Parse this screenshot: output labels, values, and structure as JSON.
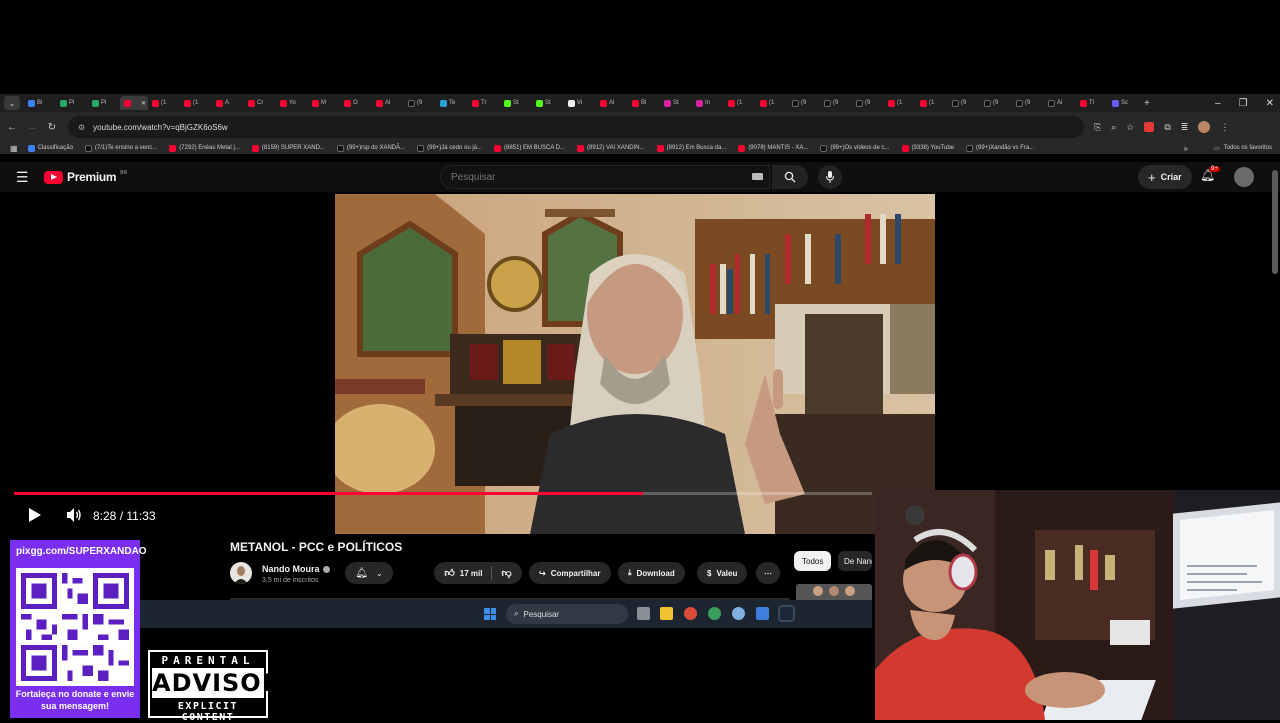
{
  "browser": {
    "tabs": [
      {
        "label": "Bi",
        "icon": "bl"
      },
      {
        "label": "Pi",
        "icon": "gr"
      },
      {
        "label": "Pi",
        "icon": "gr"
      },
      {
        "label": "",
        "icon": "yt",
        "active": true
      },
      {
        "label": "(1",
        "icon": "yt"
      },
      {
        "label": "(1",
        "icon": "yt"
      },
      {
        "label": "A",
        "icon": "yt"
      },
      {
        "label": "Cr",
        "icon": "yt"
      },
      {
        "label": "Yo",
        "icon": "yt"
      },
      {
        "label": "M",
        "icon": "yt"
      },
      {
        "label": "O",
        "icon": "yt"
      },
      {
        "label": "Al",
        "icon": "yt"
      },
      {
        "label": "(9",
        "icon": "tt"
      },
      {
        "label": "Te",
        "icon": "tg"
      },
      {
        "label": "Tr",
        "icon": "yt"
      },
      {
        "label": "St",
        "icon": "kk"
      },
      {
        "label": "St",
        "icon": "kk"
      },
      {
        "label": "Vi",
        "icon": "gg"
      },
      {
        "label": "Al",
        "icon": "yt"
      },
      {
        "label": "Bl",
        "icon": "yt"
      },
      {
        "label": "St",
        "icon": "ig"
      },
      {
        "label": "In",
        "icon": "ig"
      },
      {
        "label": "(1",
        "icon": "yt"
      },
      {
        "label": "(1",
        "icon": "yt"
      },
      {
        "label": "(9",
        "icon": "tt"
      },
      {
        "label": "(9",
        "icon": "tt"
      },
      {
        "label": "(9",
        "icon": "tt"
      },
      {
        "label": "(1",
        "icon": "yt"
      },
      {
        "label": "(1",
        "icon": "yt"
      },
      {
        "label": "(9",
        "icon": "tt"
      },
      {
        "label": "(9",
        "icon": "tt"
      },
      {
        "label": "(9",
        "icon": "tt"
      },
      {
        "label": "Ai",
        "icon": "tt"
      },
      {
        "label": "Tl",
        "icon": "yt"
      },
      {
        "label": "Sc",
        "icon": "pr"
      }
    ],
    "new_tab": "+",
    "window_controls": {
      "minimize": "–",
      "restore": "❐",
      "close": "✕"
    },
    "url": "youtube.com/watch?v=qBjGZK6oS6w",
    "bookmarks": [
      {
        "label": "Classificação",
        "icon": "bl"
      },
      {
        "label": "(7/1)Te ensino a venc...",
        "icon": "tt"
      },
      {
        "label": "(7292) Enéas Metal |...",
        "icon": "yt"
      },
      {
        "label": "(8159) SUPER XAND...",
        "icon": "yt"
      },
      {
        "label": "(99+)rsp do XANDÃ...",
        "icon": "tt"
      },
      {
        "label": "(99+)Já cedo ou já...",
        "icon": "tt"
      },
      {
        "label": "(8851) EM BUSCA D...",
        "icon": "yt"
      },
      {
        "label": "(8912) VAI XANDIN...",
        "icon": "yt"
      },
      {
        "label": "(8912) Em Busca da...",
        "icon": "yt"
      },
      {
        "label": "(9078) MANTIS - XA...",
        "icon": "yt"
      },
      {
        "label": "(99+)Os vídeos de c...",
        "icon": "tt"
      },
      {
        "label": "(9338) YouTube",
        "icon": "yt"
      },
      {
        "label": "(99+)Xandão vs Fra...",
        "icon": "tt"
      }
    ],
    "bookmarks_more": "»",
    "all_bookmarks": "Todos os favoritos"
  },
  "youtube": {
    "brand": "Premium",
    "country": "BR",
    "search_placeholder": "Pesquisar",
    "create_label": "Criar",
    "notif_badge": "9+",
    "player": {
      "current_time": "8:28",
      "duration": "11:33",
      "time_text": "8:28 / 11:33",
      "progress": 0.733
    },
    "video_title": "METANOL - PCC e POLÍTICOS",
    "channel_name": "Nando Moura",
    "subscribers": "3,5 mi de inscritos",
    "likes": "17 mil",
    "share_label": "Compartilhar",
    "download_label": "Download",
    "thanks_label": "Valeu",
    "chips": [
      "Todos",
      "De Nando Moura"
    ]
  },
  "taskbar": {
    "search_placeholder": "Pesquisar"
  },
  "overlay": {
    "qr_url": "pixgg.com/SUPERXANDAO",
    "qr_caption": "Fortaleça no donate e envie sua mensagem!",
    "advisory_top": "PARENTAL",
    "advisory_mid": "ADVISORY",
    "advisory_bottom": "EXPLICIT CONTENT"
  },
  "colors": {
    "yt_red": "#ff0033",
    "qr_purple": "#7a2ff0",
    "taskbar": "#1c2530"
  }
}
